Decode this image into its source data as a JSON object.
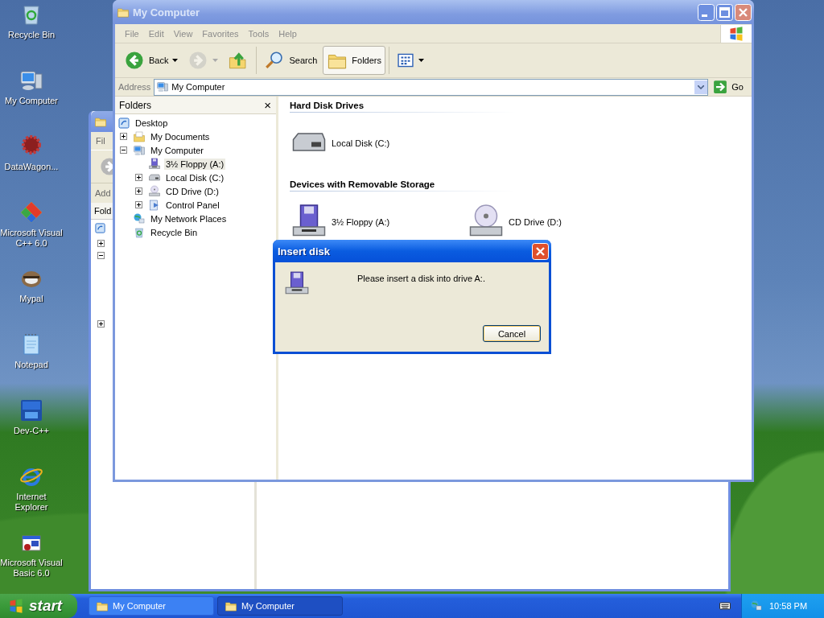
{
  "desktop_icons": [
    {
      "label": "Recycle Bin"
    },
    {
      "label": "My Computer"
    },
    {
      "label": "DataWagon..."
    },
    {
      "label": "Microsoft Visual C++ 6.0"
    },
    {
      "label": "Mypal"
    },
    {
      "label": "Notepad"
    },
    {
      "label": "Dev-C++"
    },
    {
      "label": "Internet Explorer"
    },
    {
      "label": "Microsoft Visual Basic 6.0"
    }
  ],
  "background_window": {
    "menu_item": "Fil",
    "address_label": "Add",
    "folders_title": "Fold"
  },
  "window": {
    "title": "My Computer",
    "menu": [
      "File",
      "Edit",
      "View",
      "Favorites",
      "Tools",
      "Help"
    ],
    "toolbar": [
      {
        "kind": "back",
        "label": "Back",
        "selected": false,
        "disabled": false
      },
      {
        "kind": "forward",
        "selected": false,
        "disabled": true
      },
      {
        "kind": "up",
        "selected": false,
        "disabled": false
      },
      {
        "kind": "search",
        "label": "Search",
        "selected": false,
        "disabled": false
      },
      {
        "kind": "folders",
        "label": "Folders",
        "selected": true,
        "disabled": false
      },
      {
        "kind": "views",
        "selected": false,
        "disabled": false
      }
    ],
    "address": {
      "label": "Address",
      "value": "My Computer",
      "go": "Go"
    },
    "folders": {
      "title": "Folders",
      "close": "×",
      "tree": [
        {
          "label": "Desktop",
          "selected": false,
          "children": [
            {
              "label": "My Documents",
              "selected": false,
              "expanded": false
            },
            {
              "label": "My Computer",
              "selected": false,
              "expanded": true,
              "children": [
                {
                  "label": "3½ Floppy (A:)",
                  "selected": true
                },
                {
                  "label": "Local Disk (C:)",
                  "selected": false,
                  "expanded": false
                },
                {
                  "label": "CD Drive (D:)",
                  "selected": false,
                  "expanded": false
                },
                {
                  "label": "Control Panel",
                  "selected": false,
                  "expanded": false
                }
              ]
            },
            {
              "label": "My Network Places",
              "selected": false
            },
            {
              "label": "Recycle Bin",
              "selected": false
            }
          ]
        }
      ]
    },
    "groups": [
      {
        "title": "Hard Disk Drives",
        "items": [
          {
            "label": "Local Disk (C:)"
          }
        ]
      },
      {
        "title": "Devices with Removable Storage",
        "items": [
          {
            "label": "3½ Floppy (A:)"
          },
          {
            "label": "CD Drive (D:)"
          }
        ]
      }
    ]
  },
  "dialog": {
    "title": "Insert disk",
    "message": "Please insert a disk into drive A:.",
    "button": "Cancel"
  },
  "taskbar": {
    "start": "start",
    "tasks": [
      {
        "label": "My Computer",
        "selected": false
      },
      {
        "label": "My Computer",
        "selected": true
      }
    ],
    "clock": "10:58 PM"
  }
}
